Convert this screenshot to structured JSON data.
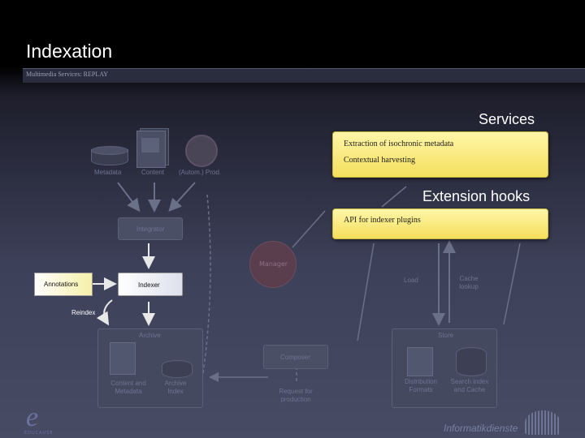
{
  "title": "Indexation",
  "subtitle": "Multimedia Services: REPLAY",
  "sources": {
    "metadata": "Metadata",
    "content": "Content",
    "autom_prod": "(Autom.) Prod."
  },
  "services": {
    "heading": "Services",
    "items": [
      "Extraction of isochronic metadata",
      "Contextual harvesting"
    ]
  },
  "extension": {
    "heading": "Extension hooks",
    "item": "API for indexer plugins"
  },
  "integrator": "Integrator",
  "manager": "Manager",
  "annotations": "Annotations",
  "indexer": "Indexer",
  "reindex": "Reindex",
  "load": "Load",
  "cache_lookup": "Cache lookup",
  "archive": {
    "label": "Archive",
    "content_meta": "Content and Metadata",
    "archive_index": "Archive Index"
  },
  "composer": "Composer",
  "request": "Request for production",
  "store": {
    "label": "Store",
    "distribution": "Distribution Formats",
    "search_index": "Search index and Cache"
  },
  "footer": {
    "logo_left": "e",
    "logo_left_sub": "EDUCAUSE",
    "logo_right": "Informatikdienste"
  }
}
